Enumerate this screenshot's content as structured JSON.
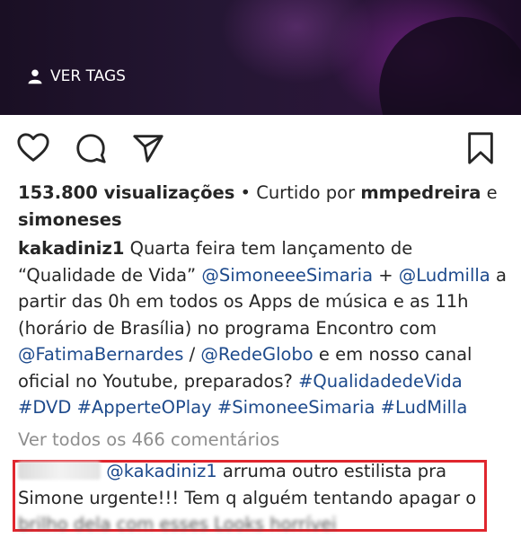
{
  "media": {
    "tags_label": "VER TAGS"
  },
  "actions": {
    "like_icon": "heart-icon",
    "comment_icon": "comment-icon",
    "share_icon": "send-icon",
    "save_icon": "bookmark-icon"
  },
  "post": {
    "views": "153.800 visualizações",
    "liked_by_prefix": " • Curtido por ",
    "liked_by_user": "mmpedreira",
    "liked_by_and": " e",
    "liked_by_user2": "simoneses",
    "author": "kakadiniz1",
    "caption_1": " Quarta feira tem lançamento de “Qualidade de Vida” ",
    "mention_1": "@SimoneeeSimaria",
    "caption_2": " + ",
    "mention_2": "@Ludmilla",
    "caption_3": " a partir das 0h em todos os Apps de música e as 11h (horário de Brasília) no programa Encontro com ",
    "mention_3": "@FatimaBernardes",
    "caption_4": " / ",
    "mention_4": "@RedeGlobo",
    "caption_5": " e em nosso canal oficial no Youtube, preparados? ",
    "hashtag_1": "#QualidadedeVida",
    "hashtag_2": "#DVD",
    "hashtag_3": "#ApperteOPlay",
    "hashtag_4": "#SimoneeSimaria",
    "hashtag_5": "#LudMilla",
    "view_all_comments": "Ver todos os 466 comentários"
  },
  "comment": {
    "mention": "@kakadiniz1",
    "text": " arruma outro estilista pra Simone urgente!!! Tem q alguém tentando apagar o",
    "clipped_line": "brilho dela com esses Looks horrívei"
  },
  "colors": {
    "link": "#1d4a8c",
    "muted": "#8e8e8e",
    "highlight_border": "#e0262e"
  }
}
